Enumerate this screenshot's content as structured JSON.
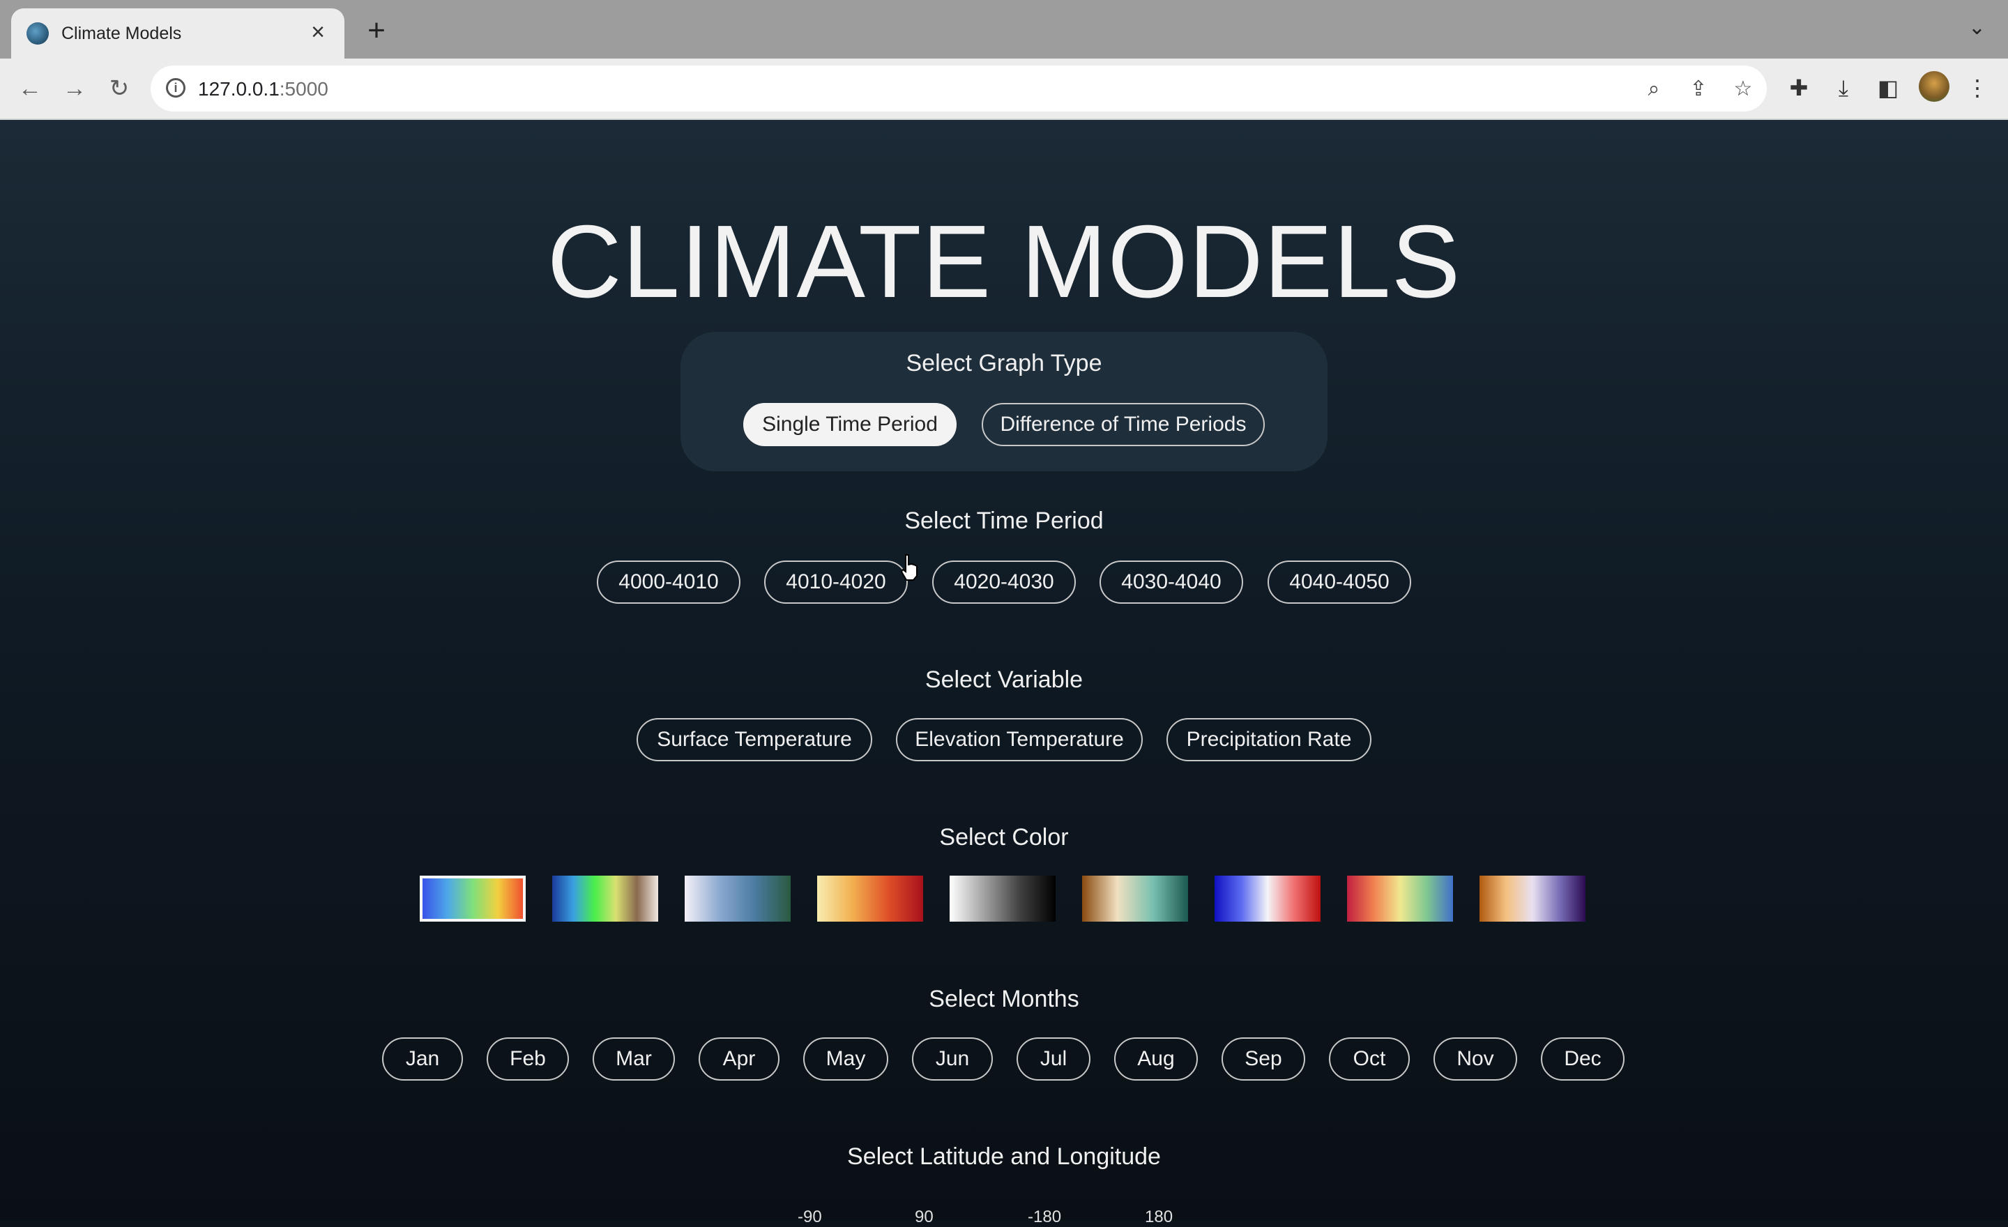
{
  "browser": {
    "tab_title": "Climate Models",
    "url_host": "127.0.0.1",
    "url_port": ":5000"
  },
  "page": {
    "title": "CLIMATE MODELS",
    "graph_type": {
      "label": "Select Graph Type",
      "options": [
        "Single Time Period",
        "Difference of Time Periods"
      ],
      "selected": "Single Time Period"
    },
    "time_period": {
      "label": "Select Time Period",
      "options": [
        "4000-4010",
        "4010-4020",
        "4020-4030",
        "4030-4040",
        "4040-4050"
      ]
    },
    "variable": {
      "label": "Select Variable",
      "options": [
        "Surface Temperature",
        "Elevation Temperature",
        "Precipitation Rate"
      ]
    },
    "color": {
      "label": "Select Color",
      "selected_index": 0,
      "swatches": [
        [
          "#3a52e8",
          "#4ea8e8",
          "#7fe07a",
          "#f2d040",
          "#f05030"
        ],
        [
          "#1a3a9a",
          "#3aa0e0",
          "#4aee4a",
          "#d8e070",
          "#8a6a50",
          "#f0e8e0"
        ],
        [
          "#f4f0f8",
          "#8aa8d0",
          "#4a7aa0",
          "#2a5a40"
        ],
        [
          "#f8ecb0",
          "#f2b050",
          "#e05028",
          "#a8101c"
        ],
        [
          "#ffffff",
          "#a0a0a0",
          "#404040",
          "#000000"
        ],
        [
          "#8a4a10",
          "#f0e0c0",
          "#7ac0b0",
          "#1a5a50"
        ],
        [
          "#1010c0",
          "#5a6af0",
          "#f4f4f8",
          "#f07070",
          "#c01010"
        ],
        [
          "#c02040",
          "#f08050",
          "#f0e890",
          "#80c890",
          "#4070c8"
        ],
        [
          "#b05a10",
          "#f4c080",
          "#e8e0f0",
          "#7a70b8",
          "#2a0a50"
        ]
      ]
    },
    "months": {
      "label": "Select Months",
      "options": [
        "Jan",
        "Feb",
        "Mar",
        "Apr",
        "May",
        "Jun",
        "Jul",
        "Aug",
        "Sep",
        "Oct",
        "Nov",
        "Dec"
      ]
    },
    "lat_lon": {
      "label": "Select Latitude and Longitude",
      "values": [
        "-90",
        "90",
        "-180",
        "180"
      ]
    }
  }
}
